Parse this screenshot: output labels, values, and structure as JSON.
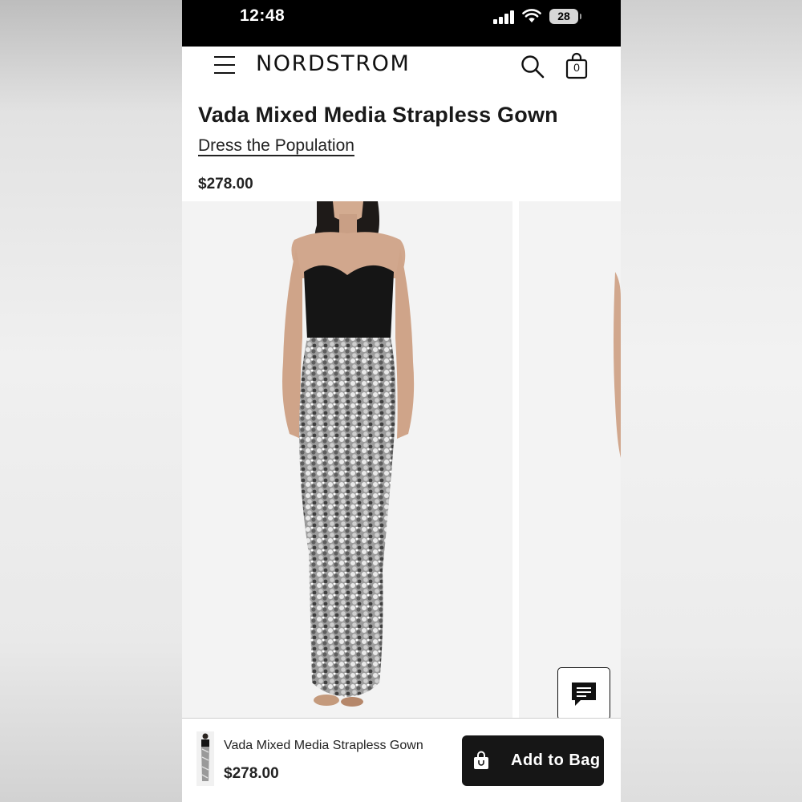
{
  "status_bar": {
    "time": "12:48",
    "battery": "28",
    "icons": [
      "cellular-signal-icon",
      "wifi-icon",
      "battery-icon"
    ]
  },
  "header": {
    "brand": "NORDSTROM",
    "bag_count": "0",
    "icons": [
      "menu-icon",
      "search-icon",
      "shopping-bag-icon"
    ]
  },
  "product": {
    "title": "Vada Mixed Media Strapless Gown",
    "brand_link": "Dress the Population",
    "price": "$278.00"
  },
  "bottom_bar": {
    "title": "Vada Mixed Media Strapless Gown",
    "price": "$278.00",
    "add_to_bag_label": "Add to Bag",
    "icons": [
      "product-thumbnail",
      "shopping-bag-icon"
    ]
  },
  "chat": {
    "icon": "chat-icon"
  },
  "colors": {
    "status_bar_bg": "#000000",
    "text_primary": "#191919",
    "button_bg": "#161616",
    "button_text": "#ffffff",
    "image_bg": "#f3f3f3"
  }
}
